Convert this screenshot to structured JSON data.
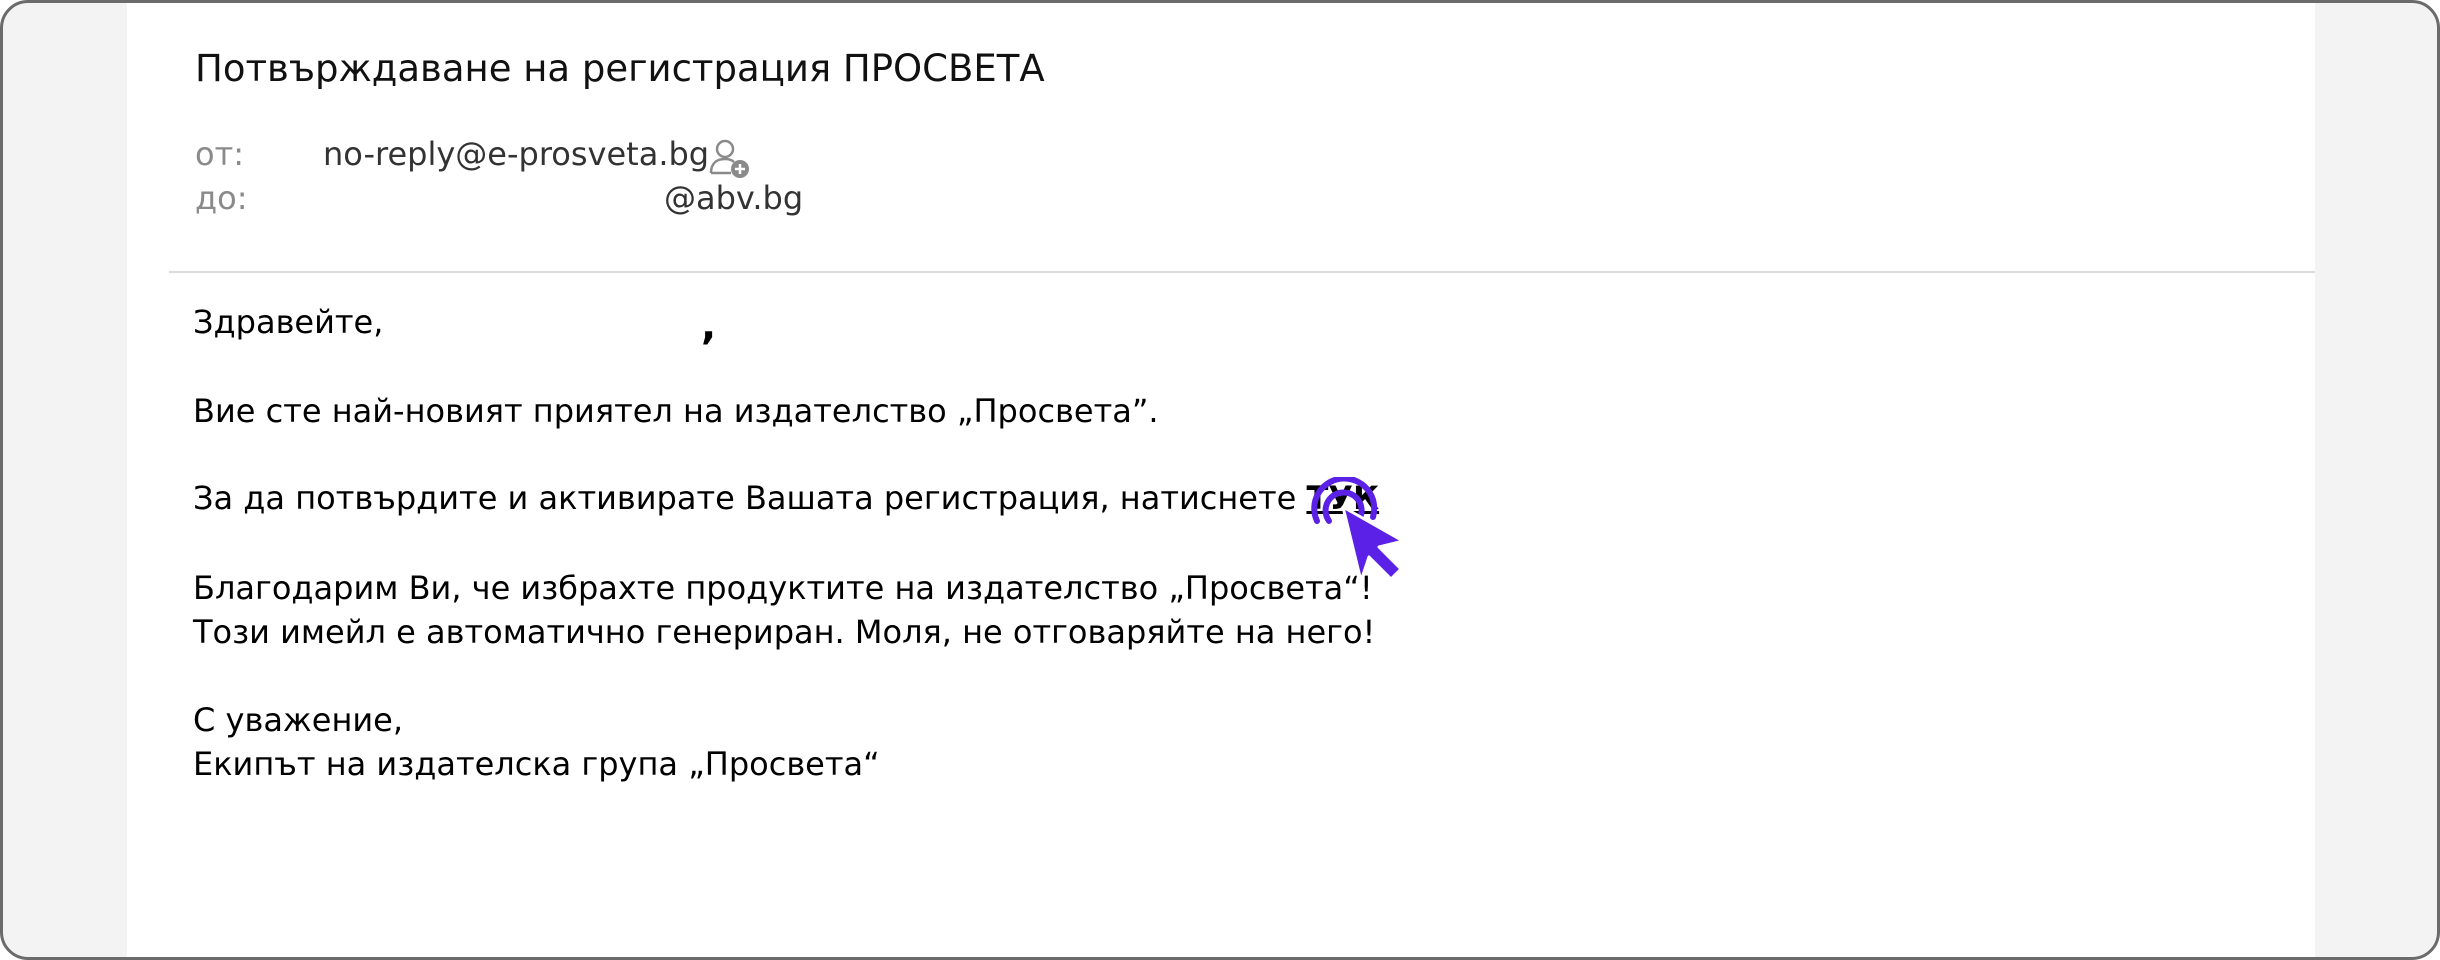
{
  "email": {
    "subject": "Потвърждаване на регистрация ПРОСВЕТА",
    "from_label": "от:",
    "from_address": "no-reply@e-prosveta.bg",
    "to_label": "до:",
    "to_address": "@abv.bg",
    "add_contact_icon": "add-contact-icon"
  },
  "body": {
    "greeting": "Здравейте,",
    "greeting_comma": ",",
    "intro": "Вие сте най-новият приятел на издателство „Просвета”.",
    "confirm_text": "За да потвърдите и активирате Вашата регистрация, натиснете ",
    "confirm_link": "ТУК",
    "thanks": "Благодарим Ви, че избрахте продуктите на издателство „Просвета“!",
    "auto_notice": "Този имейл е автоматично генериран. Моля, не отговаряйте на него!",
    "closing": "С уважение,",
    "signature": "Екипът на издателска група „Просвета“"
  },
  "colors": {
    "pointer_accent": "#5b21e6",
    "label_gray": "#8a8a8a",
    "divider": "#dcdcdc"
  },
  "icons": {
    "pointer": "click-pointer-icon"
  }
}
